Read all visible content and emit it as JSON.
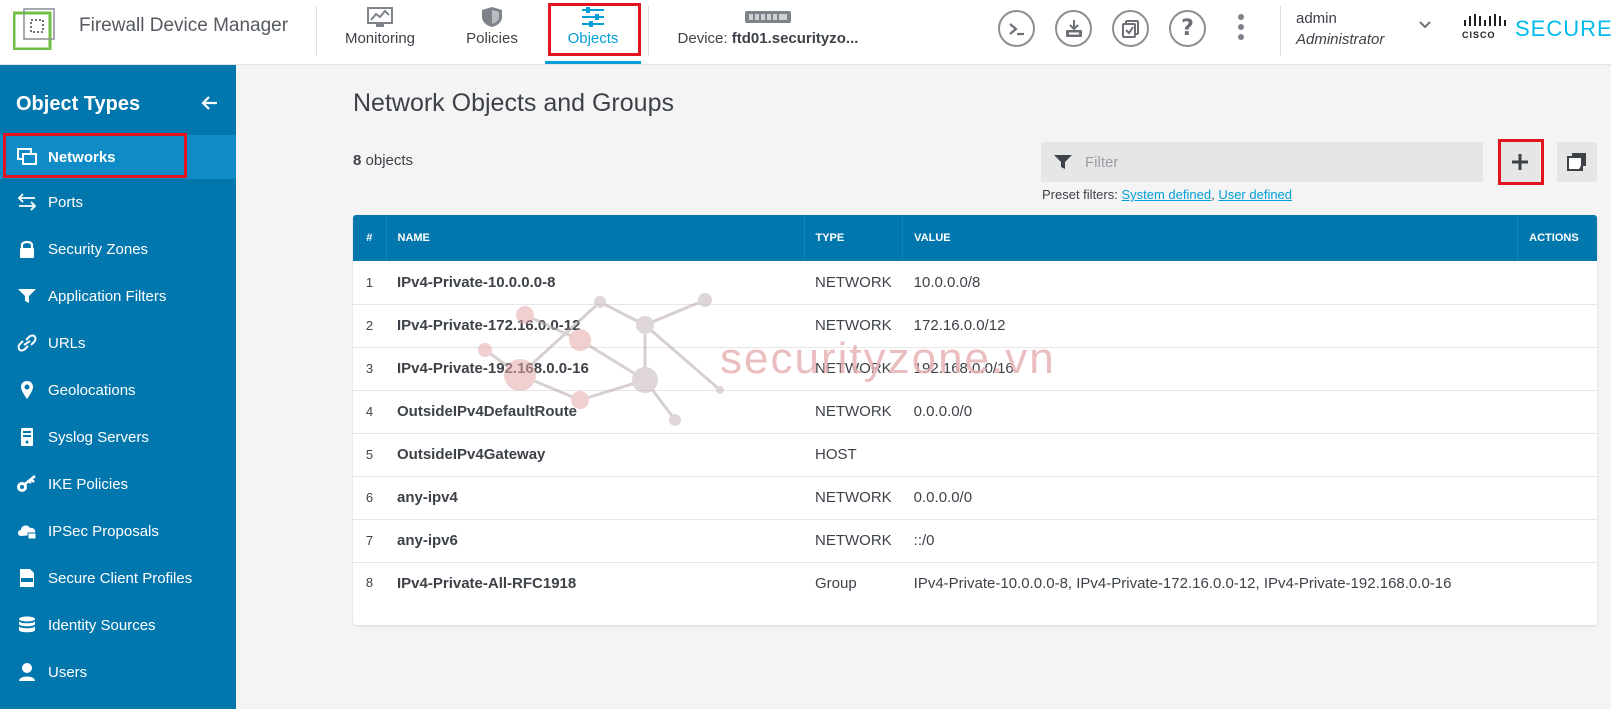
{
  "app": {
    "title": "Firewall Device Manager"
  },
  "nav": {
    "tabs": [
      {
        "label": "Monitoring",
        "icon": "monitoring-icon"
      },
      {
        "label": "Policies",
        "icon": "policies-shield-icon"
      },
      {
        "label": "Objects",
        "icon": "objects-sliders-icon",
        "active": true
      }
    ],
    "device_prefix": "Device: ",
    "device_name": "ftd01.securityzo..."
  },
  "user": {
    "name": "admin",
    "role": "Administrator"
  },
  "brand": {
    "logo_text": "SECURE",
    "cisco": "CISCO",
    "accent": "#00bceb"
  },
  "sidebar": {
    "title": "Object Types",
    "items": [
      {
        "label": "Networks",
        "icon": "network-icon",
        "selected": true
      },
      {
        "label": "Ports",
        "icon": "ports-arrows-icon"
      },
      {
        "label": "Security Zones",
        "icon": "lock-icon"
      },
      {
        "label": "Application Filters",
        "icon": "app-filter-icon"
      },
      {
        "label": "URLs",
        "icon": "link-icon"
      },
      {
        "label": "Geolocations",
        "icon": "location-pin-icon"
      },
      {
        "label": "Syslog Servers",
        "icon": "syslog-server-icon"
      },
      {
        "label": "IKE Policies",
        "icon": "key-icon"
      },
      {
        "label": "IPSec Proposals",
        "icon": "cloud-lock-icon"
      },
      {
        "label": "Secure Client Profiles",
        "icon": "xml-file-icon"
      },
      {
        "label": "Identity Sources",
        "icon": "database-icon"
      },
      {
        "label": "Users",
        "icon": "user-icon"
      }
    ]
  },
  "main": {
    "title": "Network Objects and Groups",
    "count_value": "8",
    "count_suffix": " objects",
    "filter_placeholder": "Filter",
    "preset_label": "Preset filters: ",
    "preset_links": [
      "System defined",
      "User defined"
    ],
    "table": {
      "headers": [
        "#",
        "NAME",
        "TYPE",
        "VALUE",
        "ACTIONS"
      ],
      "rows": [
        {
          "num": "1",
          "name": "IPv4-Private-10.0.0.0-8",
          "type": "NETWORK",
          "value": "10.0.0.0/8"
        },
        {
          "num": "2",
          "name": "IPv4-Private-172.16.0.0-12",
          "type": "NETWORK",
          "value": "172.16.0.0/12"
        },
        {
          "num": "3",
          "name": "IPv4-Private-192.168.0.0-16",
          "type": "NETWORK",
          "value": "192.168.0.0/16"
        },
        {
          "num": "4",
          "name": "OutsideIPv4DefaultRoute",
          "type": "NETWORK",
          "value": "0.0.0.0/0"
        },
        {
          "num": "5",
          "name": "OutsideIPv4Gateway",
          "type": "HOST",
          "value": ""
        },
        {
          "num": "6",
          "name": "any-ipv4",
          "type": "NETWORK",
          "value": "0.0.0.0/0"
        },
        {
          "num": "7",
          "name": "any-ipv6",
          "type": "NETWORK",
          "value": "::/0"
        },
        {
          "num": "8",
          "name": "IPv4-Private-All-RFC1918",
          "type": "Group",
          "value": "IPv4-Private-10.0.0.0-8, IPv4-Private-172.16.0.0-12, IPv4-Private-192.168.0.0-16"
        }
      ]
    }
  },
  "watermark": {
    "text": "securityzone.vn"
  },
  "colors": {
    "primary": "#0277ad",
    "link": "#049fd9",
    "highlight": "#e3131f"
  }
}
